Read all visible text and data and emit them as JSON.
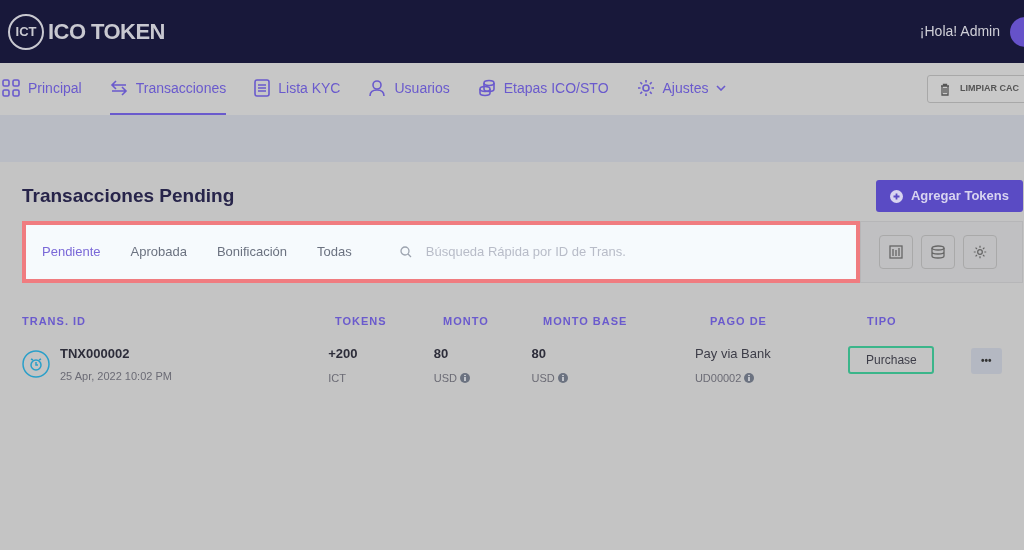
{
  "header": {
    "logo_mark": "ICT",
    "logo_text": "ICO TOKEN",
    "greeting": "¡Hola! Admin"
  },
  "nav": [
    {
      "label": "Principal",
      "selected": false
    },
    {
      "label": "Transacciones",
      "selected": true
    },
    {
      "label": "Lista KYC",
      "selected": false
    },
    {
      "label": "Usuarios",
      "selected": false
    },
    {
      "label": "Etapas ICO/STO",
      "selected": false
    },
    {
      "label": "Ajustes",
      "selected": false,
      "dropdown": true
    }
  ],
  "clear_cache_button": "LIMPIAR CAC",
  "page_title": "Transacciones Pending",
  "add_button": "Agregar Tokens",
  "filter_tabs": [
    {
      "label": "Pendiente",
      "selected": true
    },
    {
      "label": "Aprobada",
      "selected": false
    },
    {
      "label": "Bonificación",
      "selected": false
    },
    {
      "label": "Todas",
      "selected": false
    }
  ],
  "search": {
    "placeholder": "Búsqueda Rápida por ID de Trans."
  },
  "table": {
    "columns": [
      "TRANS. ID",
      "TOKENS",
      "MONTO",
      "MONTO BASE",
      "PAGO DE",
      "TIPO"
    ],
    "rows": [
      {
        "id": "TNX000002",
        "date": "25 Apr, 2022 10:02 PM",
        "tokens": "+200",
        "token_unit": "ICT",
        "amount": "80",
        "amount_currency": "USD",
        "base_amount": "80",
        "base_currency": "USD",
        "pay_method": "Pay via Bank",
        "pay_ref": "UD00002",
        "type": "Purchase",
        "more": "•••"
      }
    ]
  }
}
